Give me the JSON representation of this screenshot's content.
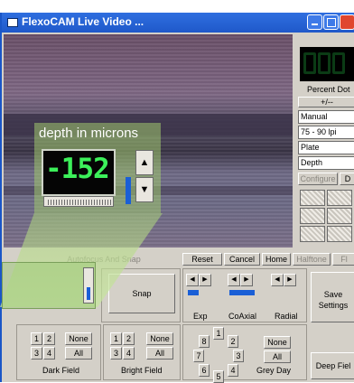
{
  "window": {
    "title": "FlexoCAM Live Video ..."
  },
  "right_panel": {
    "percent_dot_label": "Percent Dot",
    "plus_minus_label": "+/--",
    "combos": [
      "Manual",
      "75 - 90 lpi",
      "Plate",
      "Depth"
    ],
    "configure_label": "Configure",
    "configure_next": "D"
  },
  "callout": {
    "label": "depth in microns",
    "reading": "-152"
  },
  "bottom_buttons": {
    "autofocus": "Autofocus And Snap",
    "reset": "Reset",
    "cancel": "Cancel",
    "home": "Home",
    "halftone": "Halftone",
    "fl": "Fl"
  },
  "controls": {
    "snap": "Snap",
    "exp": "Exp",
    "coaxial": "CoAxial",
    "radial": "Radial",
    "save_settings_1": "Save",
    "save_settings_2": "Settings",
    "deep_field": "Deep Fiel"
  },
  "dark_field": {
    "buttons": [
      "1",
      "2",
      "3",
      "4"
    ],
    "none": "None",
    "all": "All",
    "label": "Dark Field"
  },
  "bright_field": {
    "buttons": [
      "1",
      "2",
      "3",
      "4"
    ],
    "none": "None",
    "all": "All",
    "label": "Bright Field"
  },
  "grey_day": {
    "numbers": [
      "1",
      "2",
      "3",
      "4",
      "5",
      "6",
      "7",
      "8"
    ],
    "none": "None",
    "all": "All",
    "label": "Grey Day"
  },
  "colors": {
    "title_bar": "#1f58c9",
    "lcd_green": "#3cf05a",
    "highlight_green": "#a0c86e"
  }
}
